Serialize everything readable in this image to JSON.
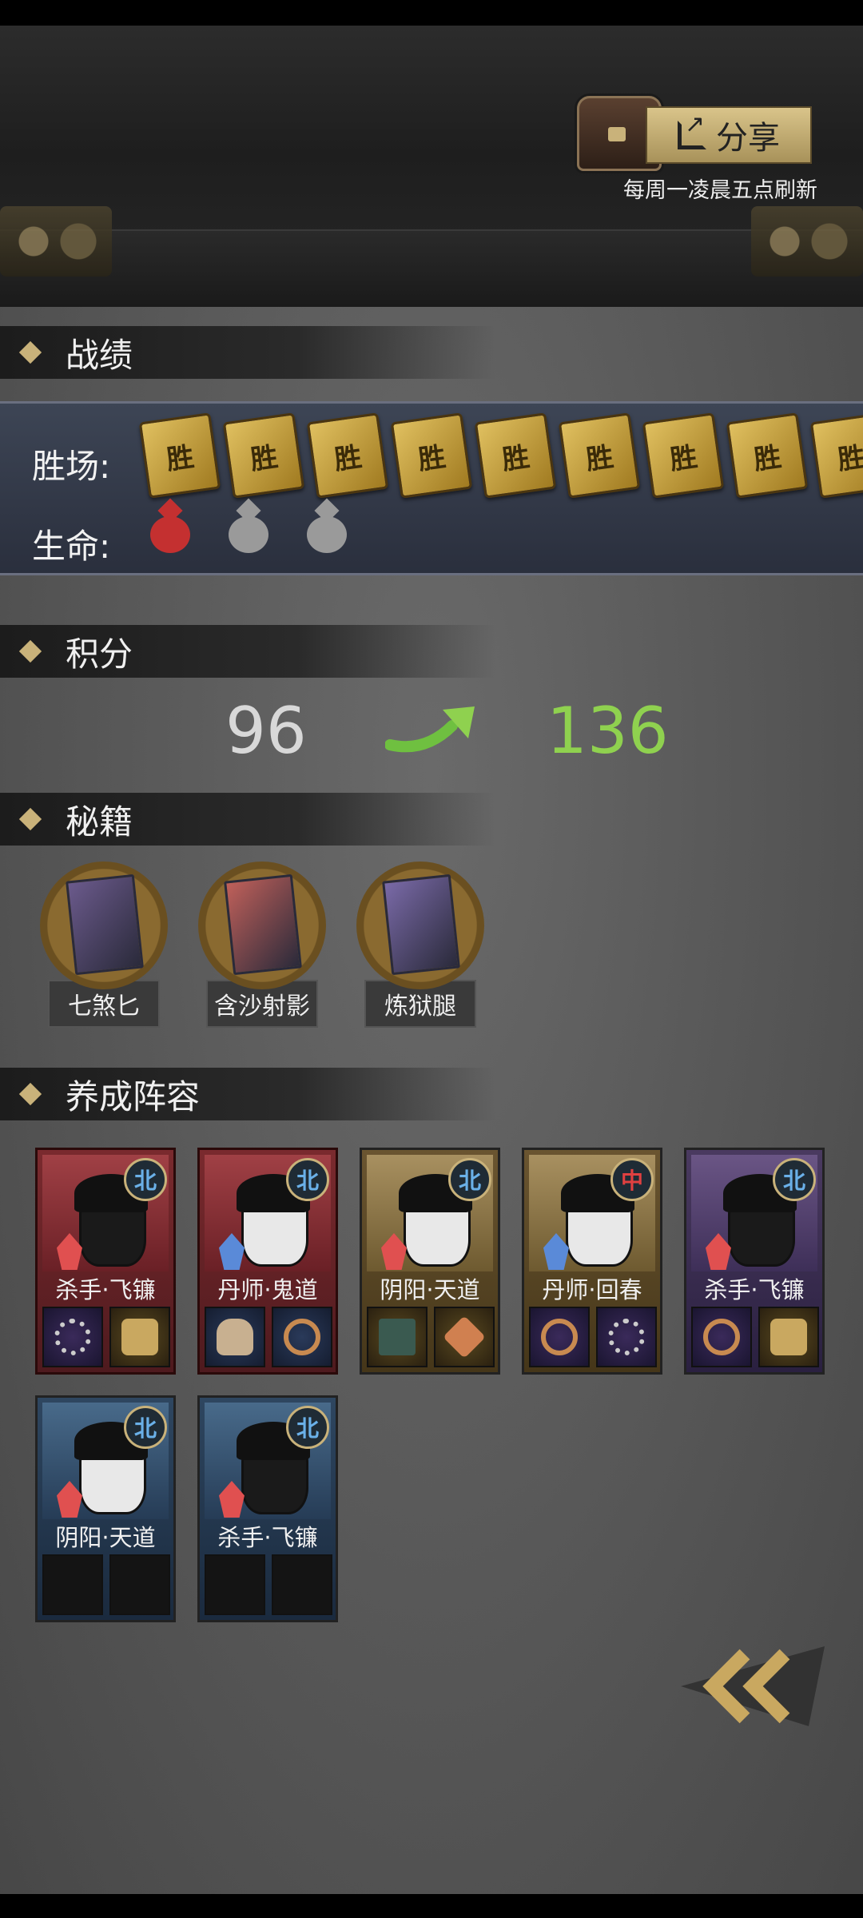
{
  "header": {
    "share_label": "分享",
    "refresh_note": "每周一凌晨五点刷新"
  },
  "sections": {
    "record": "战绩",
    "score": "积分",
    "manuals": "秘籍",
    "lineup": "养成阵容"
  },
  "record": {
    "wins_label": "胜场:",
    "lives_label": "生命:",
    "win_card_text": "胜",
    "wins": 9,
    "lives": [
      "remaining",
      "lost",
      "lost"
    ]
  },
  "score": {
    "before": "96",
    "after": "136"
  },
  "manuals": [
    {
      "name": "七煞匕",
      "color": "#6b5a8c"
    },
    {
      "name": "含沙射影",
      "color": "#c0605a"
    },
    {
      "name": "炼狱腿",
      "color": "#7a6aa8"
    }
  ],
  "lineup": [
    {
      "name": "杀手·飞镰",
      "frame": "red",
      "region": "北",
      "face": "masked",
      "role_color": "#e05050",
      "items": [
        "purple:beads",
        "gold:gold"
      ]
    },
    {
      "name": "丹师·鬼道",
      "frame": "red",
      "region": "北",
      "face": "girl",
      "role_color": "#5a8ad8",
      "items": [
        "blue:bag",
        "blue:ring"
      ]
    },
    {
      "name": "阴阳·天道",
      "frame": "gold",
      "region": "北",
      "face": "man",
      "role_color": "#e05050",
      "items": [
        "gold:box",
        "gold:cube"
      ]
    },
    {
      "name": "丹师·回春",
      "frame": "gold",
      "region": "中",
      "face": "monk",
      "role_color": "#5a8ad8",
      "items": [
        "purple:ring",
        "purple:beads"
      ]
    },
    {
      "name": "杀手·飞镰",
      "frame": "purple",
      "region": "北",
      "face": "masked",
      "role_color": "#e05050",
      "items": [
        "purple:ring",
        "gold:gold"
      ]
    },
    {
      "name": "阴阳·天道",
      "frame": "blue",
      "region": "北",
      "face": "man",
      "role_color": "#e05050",
      "items": [
        "empty:",
        "empty:"
      ]
    },
    {
      "name": "杀手·飞镰",
      "frame": "blue",
      "region": "北",
      "face": "masked",
      "role_color": "#e05050",
      "items": [
        "empty:",
        "empty:"
      ]
    }
  ],
  "icons": {
    "share": "share-icon",
    "chest": "treasure-chest-icon",
    "back": "double-chevron-left-icon",
    "score_arrow": "up-right-arrow-icon"
  },
  "colors": {
    "score_new": "#8fd14f",
    "gold_accent": "#c9b27a",
    "life_active": "#c43030"
  }
}
